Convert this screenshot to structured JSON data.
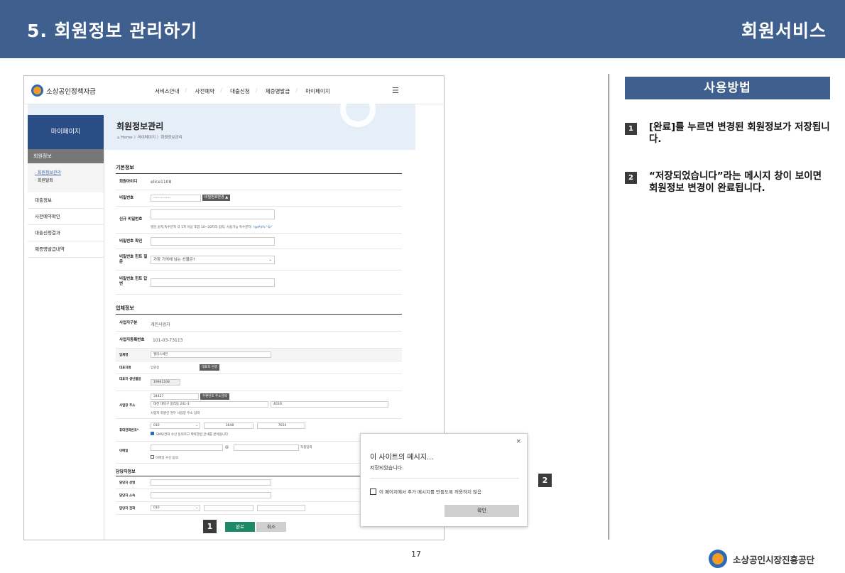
{
  "slide": {
    "title": "5. 회원정보 관리하기",
    "section": "회원서비스",
    "page_number": "17",
    "org": "소상공인시장진흥공단"
  },
  "site": {
    "logo": "소상공인정책자금",
    "menu": [
      "서비스안내",
      "사전예약",
      "대출신청",
      "제증명발급",
      "마이페이지"
    ],
    "side_title": "마이페이지",
    "side_section": "회원정보",
    "side_sub": [
      "· 회원정보관리",
      "· 회원탈퇴"
    ],
    "side_items": [
      "대출정보",
      "사전예약확인",
      "대출신청결과",
      "제증명발급내역"
    ],
    "page_title": "회원정보관리",
    "breadcrumb": "Home 〉마이페이지 〉회원정보관리"
  },
  "basic": {
    "heading": "기본정보",
    "id_label": "회원아이디",
    "id_value": "elice1108",
    "pw_label": "비밀번호",
    "pw_value": "··············",
    "pw_btn": "비밀번호변경 ▲",
    "newpw_label": "신규 비밀번호",
    "newpw_hint": "영문,숫자,특수문자 각 1자 이상 포함 10~20자리 입력, 사용가능 특수문자:",
    "newpw_chars": "!@#$%^&*",
    "pwc_label": "비밀번호 확인",
    "hintq_label": "비밀번호 힌트 질문",
    "hintq_value": "가장 기억에 남는 선물은?",
    "hinta_label": "비밀번호 힌트 답변"
  },
  "biz": {
    "heading": "업체정보",
    "type_label": "사업자구분",
    "type_value": "개인사업자",
    "regno_label": "사업자등록번호",
    "regno_value": "101-03-73113",
    "name_label": "업체명",
    "name_value": "엘리스세븐",
    "ceo_label": "대표자명",
    "ceo_value": "임현승",
    "ceo_btn": "대표자 변경",
    "birth_label": "대표자 생년월일",
    "birth_value": "19941108",
    "addr_label": "사업장 주소",
    "zip": "34427",
    "zip_btn": "우편번호 주소검색",
    "addr1": "대전 대덕구 중리동 241-3",
    "addr2": "403호",
    "addr_note": "사업자 회원인 경우 사업장 주소 입력",
    "phone_label": "휴대전화번호*",
    "p1": "010",
    "p2": "3648",
    "p3": "7654",
    "sms": "SMS/전화 수신 동의하고 제약관련 안내를 받아봅니다",
    "email_label": "이메일",
    "at": "@",
    "email_direct": "직접입력",
    "email_agree": "이메일 수신 동의"
  },
  "manager": {
    "heading": "담당자정보",
    "name_label": "담당자 성명",
    "dept_label": "담당자 소속",
    "phone_label": "담당자 전화",
    "p1": "010"
  },
  "buttons": {
    "ok": "완료",
    "cancel": "취소"
  },
  "dialog": {
    "close": "×",
    "title": "이 사이트의 메시지...",
    "message": "저장되었습니다.",
    "checkbox": "이 페이지에서 추가 메시지를 만들도록 허용하지 않음",
    "ok": "확인"
  },
  "usage": {
    "heading": "사용방법",
    "steps": [
      {
        "n": "1",
        "text": "[완료]를 누르면 변경된 회원정보가 저장됩니다."
      },
      {
        "n": "2",
        "text": "“저장되었습니다”라는 메시지 창이 보이면 회원정보 변경이 완료됩니다."
      }
    ]
  },
  "markers": {
    "one": "1",
    "two": "2"
  }
}
